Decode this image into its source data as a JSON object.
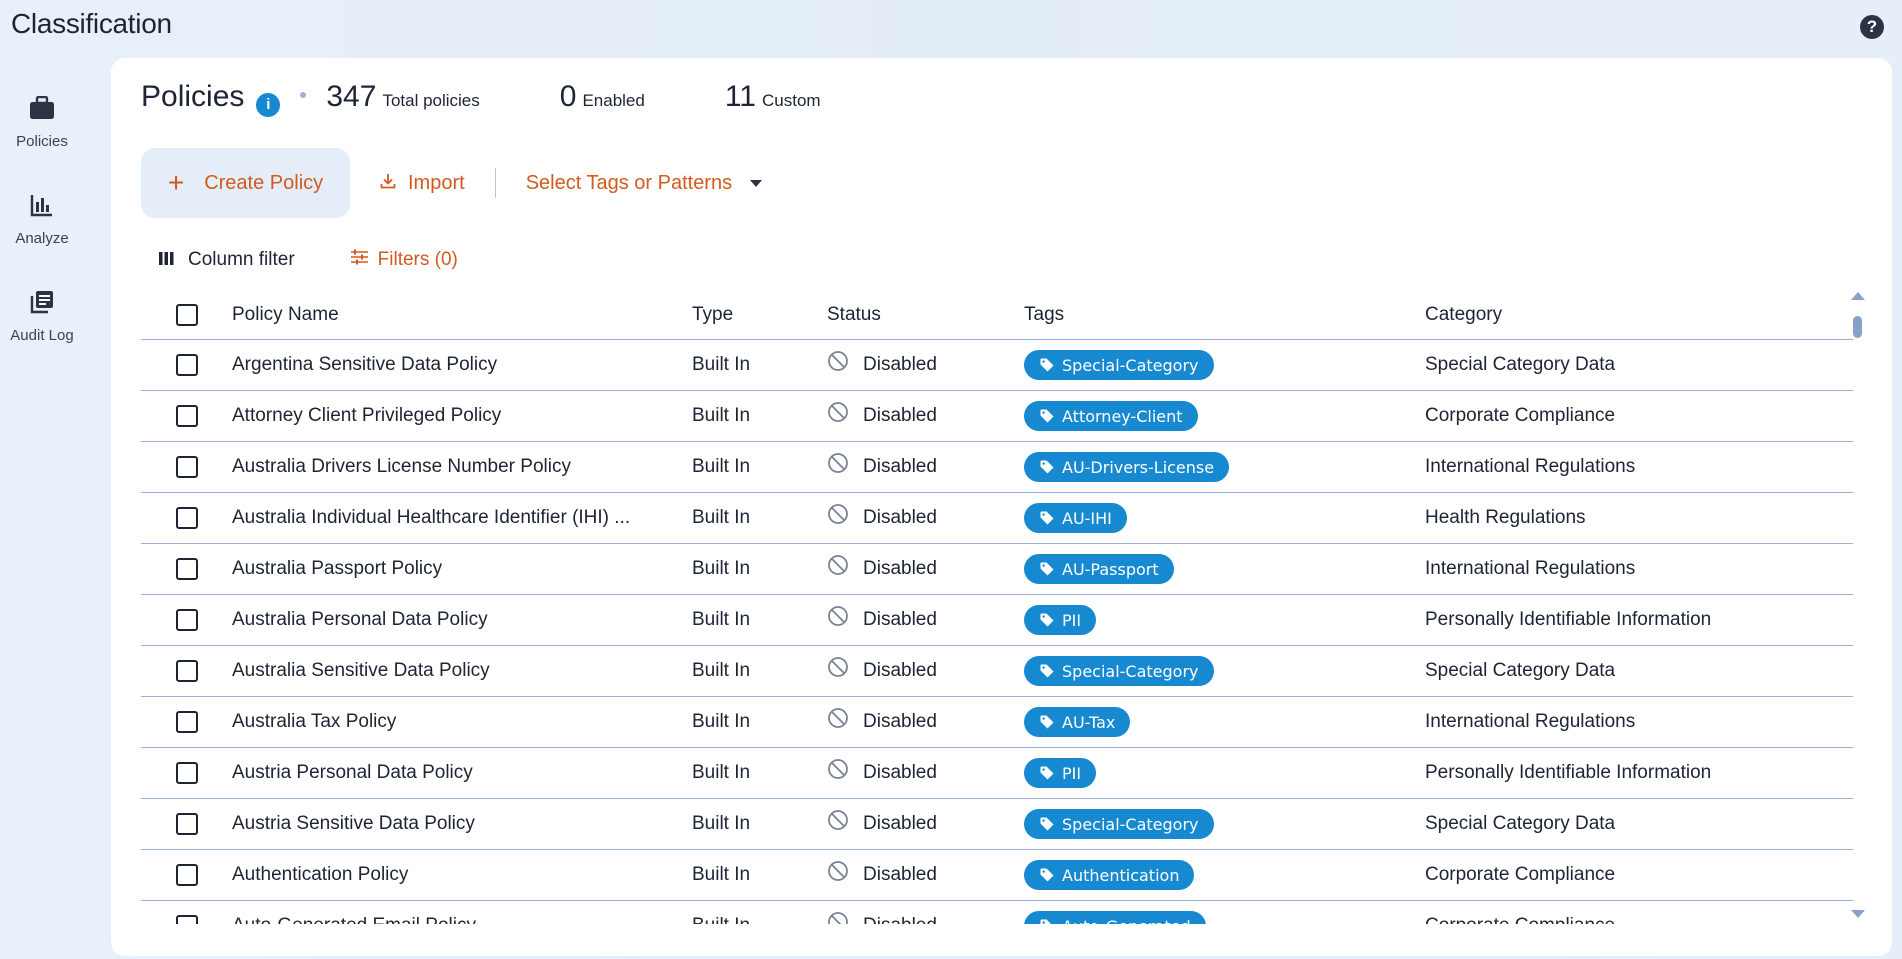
{
  "app": {
    "title": "Classification",
    "help": "?"
  },
  "sidebar": {
    "items": [
      {
        "label": "Policies",
        "icon": "briefcase-icon"
      },
      {
        "label": "Analyze",
        "icon": "bar-chart-icon"
      },
      {
        "label": "Audit Log",
        "icon": "document-stack-icon"
      }
    ]
  },
  "header": {
    "title": "Policies",
    "info": "i",
    "stats": [
      {
        "value": "347",
        "label": "Total policies"
      },
      {
        "value": "0",
        "label": "Enabled"
      },
      {
        "value": "11",
        "label": "Custom"
      }
    ]
  },
  "toolbar": {
    "create_label": "Create Policy",
    "import_label": "Import",
    "select_label": "Select Tags or Patterns"
  },
  "filterbar": {
    "column_filter_label": "Column filter",
    "filters_label": "Filters (0)"
  },
  "table": {
    "columns": [
      "Policy Name",
      "Type",
      "Status",
      "Tags",
      "Category"
    ],
    "rows": [
      {
        "name": "Argentina Sensitive Data Policy",
        "type": "Built In",
        "status": "Disabled",
        "tag": "Special-Category",
        "category": "Special Category Data"
      },
      {
        "name": "Attorney Client Privileged Policy",
        "type": "Built In",
        "status": "Disabled",
        "tag": "Attorney-Client",
        "category": "Corporate Compliance"
      },
      {
        "name": "Australia Drivers License Number Policy",
        "type": "Built In",
        "status": "Disabled",
        "tag": "AU-Drivers-License",
        "category": "International Regulations"
      },
      {
        "name": "Australia Individual Healthcare Identifier (IHI) ...",
        "type": "Built In",
        "status": "Disabled",
        "tag": "AU-IHI",
        "category": "Health Regulations"
      },
      {
        "name": "Australia Passport Policy",
        "type": "Built In",
        "status": "Disabled",
        "tag": "AU-Passport",
        "category": "International Regulations"
      },
      {
        "name": "Australia Personal Data Policy",
        "type": "Built In",
        "status": "Disabled",
        "tag": "PII",
        "category": "Personally Identifiable Information"
      },
      {
        "name": "Australia Sensitive Data Policy",
        "type": "Built In",
        "status": "Disabled",
        "tag": "Special-Category",
        "category": "Special Category Data"
      },
      {
        "name": "Australia Tax Policy",
        "type": "Built In",
        "status": "Disabled",
        "tag": "AU-Tax",
        "category": "International Regulations"
      },
      {
        "name": "Austria Personal Data Policy",
        "type": "Built In",
        "status": "Disabled",
        "tag": "PII",
        "category": "Personally Identifiable Information"
      },
      {
        "name": "Austria Sensitive Data Policy",
        "type": "Built In",
        "status": "Disabled",
        "tag": "Special-Category",
        "category": "Special Category Data"
      },
      {
        "name": "Authentication Policy",
        "type": "Built In",
        "status": "Disabled",
        "tag": "Authentication",
        "category": "Corporate Compliance"
      },
      {
        "name": "Auto-Generated Email Policy",
        "type": "Built In",
        "status": "Disabled",
        "tag": "Auto-Generated",
        "category": "Corporate Compliance"
      }
    ]
  },
  "colors": {
    "accent_orange": "#d35a1f",
    "tag_blue": "#1689d1",
    "background": "#e6eff9"
  }
}
